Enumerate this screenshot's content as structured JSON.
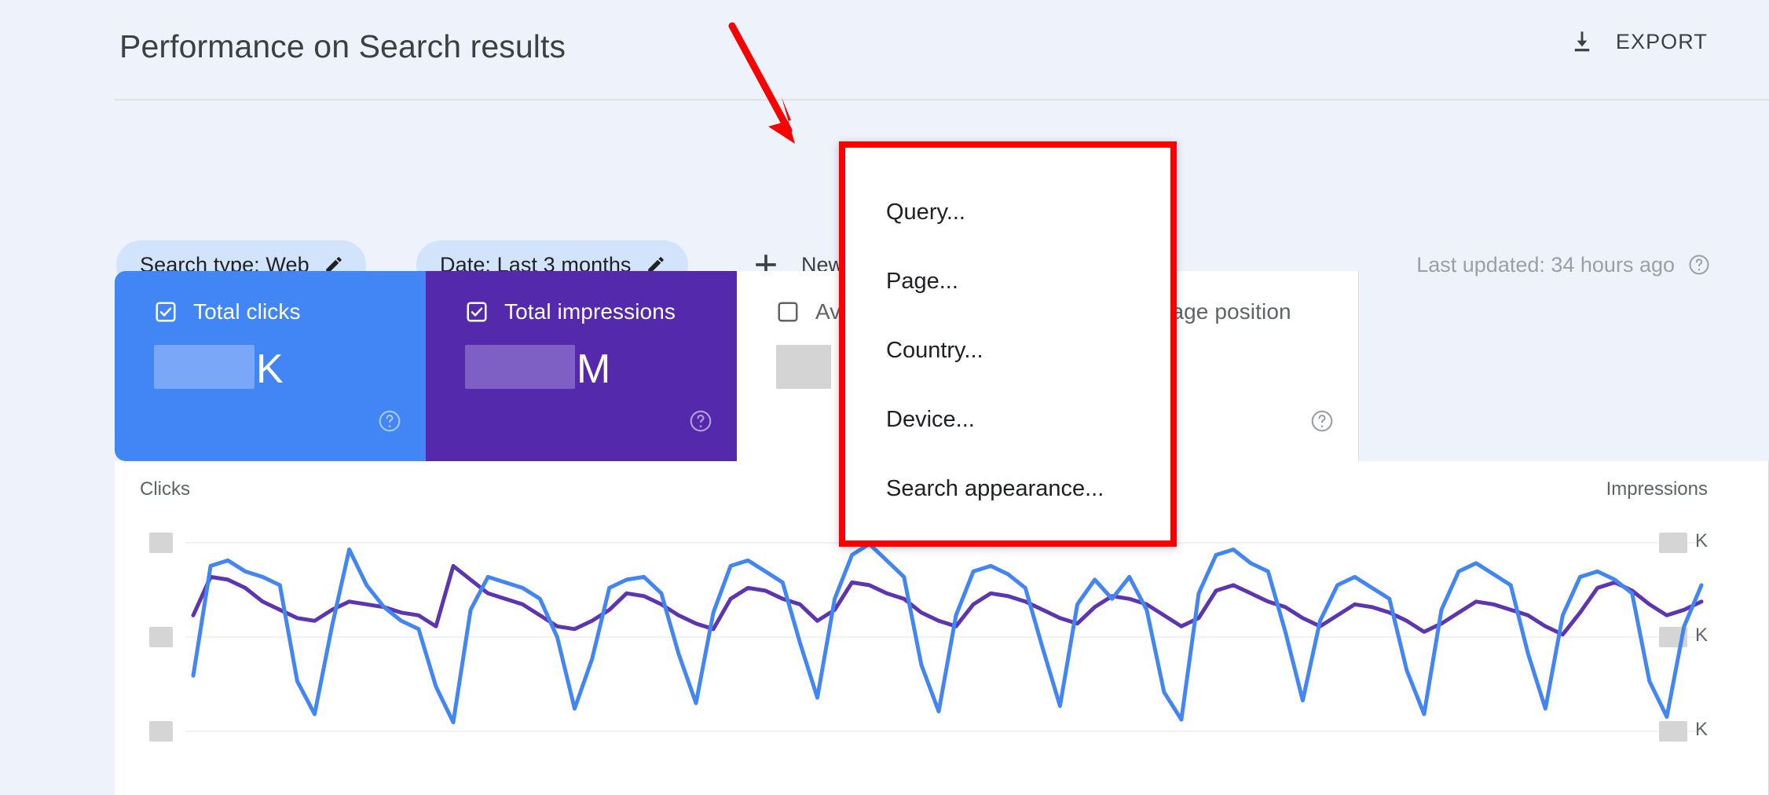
{
  "header": {
    "title": "Performance on Search results",
    "export_label": "EXPORT",
    "export_icon": "download-icon"
  },
  "filters": {
    "chips": [
      {
        "label": "Search type: Web",
        "icon": "pencil-icon"
      },
      {
        "label": "Date: Last 3 months",
        "icon": "pencil-icon"
      }
    ],
    "new_filter_label": "New",
    "new_filter_icon": "plus-icon",
    "last_updated": "Last updated: 34 hours ago",
    "last_updated_icon": "help-circle-icon"
  },
  "menu": {
    "items": [
      {
        "label": "Query..."
      },
      {
        "label": "Page..."
      },
      {
        "label": "Country..."
      },
      {
        "label": "Device..."
      },
      {
        "label": "Search appearance..."
      }
    ],
    "highlight_color": "#fa0000"
  },
  "cards": [
    {
      "title": "Total clicks",
      "checked": true,
      "value_redacted": true,
      "unit": "K",
      "color": "#4285f4",
      "help_icon": "help-circle-icon"
    },
    {
      "title": "Total impressions",
      "checked": true,
      "value_redacted": true,
      "unit": "M",
      "color": "#5429ac",
      "help_icon": "help-circle-icon"
    },
    {
      "title": "Average CTR",
      "checked": false,
      "value_redacted": true,
      "unit": "",
      "color": "#ffffff",
      "help_icon": "help-circle-icon"
    },
    {
      "title": "Average position",
      "checked": false,
      "value_redacted": true,
      "unit": "",
      "color": "#ffffff",
      "help_icon": "help-circle-icon"
    }
  ],
  "chart_data": {
    "type": "line",
    "title": "",
    "xlabel": "",
    "ylabel": "Clicks",
    "y2label": "Impressions",
    "grid": true,
    "legend": "none",
    "tick_labels_left": [
      "",
      "",
      ""
    ],
    "tick_labels_right": [
      "K",
      "K",
      "K"
    ],
    "tick_values_redacted": true,
    "axis_colors": {
      "clicks": "#4285f4",
      "impressions": "#5e35b1"
    },
    "series": [
      {
        "name": "Clicks",
        "color": "#4285f4",
        "axis": "left",
        "values": [
          22,
          62,
          64,
          60,
          58,
          55,
          20,
          8,
          40,
          68,
          55,
          47,
          42,
          39,
          18,
          5,
          46,
          58,
          56,
          54,
          50,
          36,
          10,
          28,
          54,
          57,
          58,
          52,
          30,
          12,
          45,
          62,
          64,
          60,
          56,
          34,
          14,
          50,
          66,
          70,
          64,
          58,
          26,
          9,
          44,
          60,
          62,
          59,
          54,
          32,
          11,
          48,
          57,
          50,
          58,
          46,
          16,
          6,
          52,
          66,
          68,
          63,
          60,
          38,
          13,
          42,
          55,
          58,
          54,
          50,
          24,
          8,
          46,
          60,
          63,
          59,
          55,
          30,
          10,
          44,
          58,
          60,
          57,
          52,
          20,
          7,
          40,
          55
        ]
      },
      {
        "name": "Impressions",
        "color": "#5e35b1",
        "axis": "right",
        "values": [
          44,
          58,
          57,
          54,
          49,
          46,
          43,
          42,
          46,
          49,
          48,
          47,
          45,
          44,
          40,
          62,
          57,
          52,
          50,
          48,
          44,
          40,
          39,
          42,
          46,
          52,
          51,
          48,
          44,
          41,
          39,
          50,
          54,
          53,
          50,
          48,
          42,
          46,
          56,
          55,
          52,
          50,
          45,
          42,
          40,
          48,
          52,
          51,
          49,
          46,
          43,
          41,
          47,
          51,
          50,
          48,
          44,
          40,
          43,
          53,
          55,
          52,
          49,
          47,
          43,
          40,
          44,
          48,
          47,
          45,
          42,
          38,
          41,
          45,
          49,
          48,
          46,
          44,
          40,
          37,
          45,
          54,
          56,
          53,
          48,
          44,
          46,
          49
        ]
      }
    ]
  }
}
